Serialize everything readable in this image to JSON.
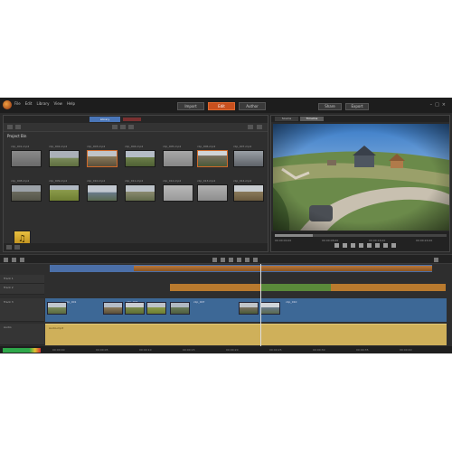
{
  "menu": {
    "items": [
      "File",
      "Edit",
      "Library",
      "View",
      "Help"
    ]
  },
  "main_tabs": [
    {
      "label": "Import",
      "active": false
    },
    {
      "label": "Edit",
      "active": true
    },
    {
      "label": "Author",
      "active": false
    }
  ],
  "right_tabs": [
    {
      "label": "Share"
    },
    {
      "label": "Export"
    }
  ],
  "library": {
    "active_tab": "Library",
    "heading": "Project Bin",
    "thumbnails": [
      {
        "label": "clip_001.mp4"
      },
      {
        "label": "clip_002.mp4"
      },
      {
        "label": "clip_003.mp4"
      },
      {
        "label": "clip_004.mp4"
      },
      {
        "label": "clip_005.mp4"
      },
      {
        "label": "clip_006.mp4"
      },
      {
        "label": "clip_007.mp4"
      },
      {
        "label": "clip_008.mp4"
      },
      {
        "label": "clip_009.mp4"
      },
      {
        "label": "clip_010.mp4"
      },
      {
        "label": "clip_011.mp4"
      },
      {
        "label": "clip_012.mp4"
      },
      {
        "label": "clip_013.mp4"
      },
      {
        "label": "clip_014.mp4"
      }
    ],
    "audio_label": "Audio.mp3"
  },
  "player": {
    "tabs": [
      {
        "label": "Source",
        "active": false
      },
      {
        "label": "Timeline",
        "active": true
      }
    ],
    "timecodes": [
      "00:00:00.00",
      "00:00:08.00",
      "00:00:16.00",
      "00:00:24.00"
    ],
    "progress": 0.22
  },
  "timeline": {
    "tracks": [
      {
        "label": "Track 1"
      },
      {
        "label": "Track 2"
      },
      {
        "label": "Track 3"
      },
      {
        "label": "Audio"
      }
    ],
    "video_clips": [
      {
        "title": "clip_001"
      },
      {
        "title": "clip_004"
      },
      {
        "title": "clip_007"
      },
      {
        "title": "clip_010"
      }
    ],
    "audio_clip_title": "Audio.mp3",
    "timecodes": [
      "00:00:00",
      "00:00:05",
      "00:00:10",
      "00:00:15",
      "00:00:20",
      "00:00:25",
      "00:00:30",
      "00:00:35",
      "00:00:40",
      "00:00:45"
    ]
  },
  "colors": {
    "accent": "#c8501e",
    "library_tab": "#4a76b8",
    "video_track": "#3d6896",
    "audio_track": "#cfb05a",
    "green_clip": "#5a8a3a",
    "orange_clip": "#b97a2e"
  },
  "icons": [
    "app-logo-icon",
    "minimize-icon",
    "maximize-icon",
    "close-icon",
    "music-note-icon",
    "play-icon",
    "stop-icon",
    "rewind-icon",
    "fast-forward-icon"
  ]
}
